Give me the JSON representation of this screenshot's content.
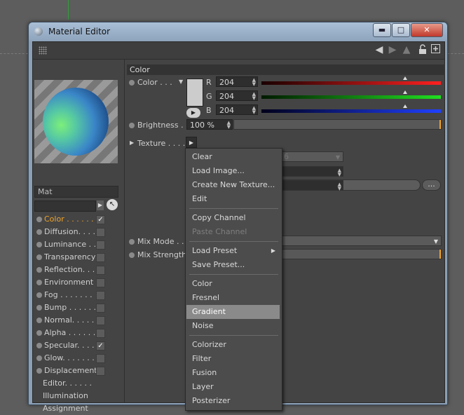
{
  "window": {
    "title": "Material Editor"
  },
  "titlebar_buttons": {
    "minimize": "▬",
    "maximize": "□",
    "close": "✕"
  },
  "material": {
    "name": "Mat"
  },
  "channels": [
    {
      "label": "Color . . . . . .",
      "checked": true,
      "active": true
    },
    {
      "label": "Diffusion. . . .",
      "checked": false
    },
    {
      "label": "Luminance . .",
      "checked": false
    },
    {
      "label": "Transparency",
      "checked": false
    },
    {
      "label": "Reflection. . .",
      "checked": false
    },
    {
      "label": "Environment",
      "checked": false
    },
    {
      "label": "Fog . . . . . . .",
      "checked": false
    },
    {
      "label": "Bump . . . . . .",
      "checked": false
    },
    {
      "label": "Normal. . . . .",
      "checked": false
    },
    {
      "label": "Alpha . . . . . .",
      "checked": false
    },
    {
      "label": "Specular. . . .",
      "checked": true
    },
    {
      "label": "Glow. . . . . . .",
      "checked": false
    },
    {
      "label": "Displacement",
      "checked": false
    }
  ],
  "other_items": [
    "Editor. . . . . .",
    "Illumination",
    "Assignment"
  ],
  "section": {
    "title": "Color"
  },
  "color_props": {
    "color_label": "Color . . .",
    "r_label": "R",
    "g_label": "G",
    "b_label": "B",
    "r_value": "204",
    "g_value": "204",
    "b_value": "204",
    "brightness_label": "Brightness . .",
    "brightness_value": "100 %",
    "texture_label": "Texture . . . . .",
    "texture_button": "Gradient",
    "texture_more": "...",
    "mix_mode_label": "Mix Mode . .",
    "mix_strength_label": "Mix Strength",
    "hidden_value": "6"
  },
  "sliders": {
    "r_level": 0.8,
    "g_level": 0.8,
    "b_level": 0.8
  },
  "context_menu": {
    "items": [
      {
        "label": "Clear"
      },
      {
        "label": "Load Image..."
      },
      {
        "label": "Create New Texture..."
      },
      {
        "label": "Edit"
      },
      {
        "label": "Copy Channel"
      },
      {
        "label": "Paste Channel",
        "disabled": true
      },
      {
        "label": "Load Preset",
        "submenu": true
      },
      {
        "label": "Save Preset..."
      },
      {
        "label": "Color"
      },
      {
        "label": "Fresnel"
      },
      {
        "label": "Gradient",
        "highlighted": true
      },
      {
        "label": "Noise"
      },
      {
        "label": "Colorizer"
      },
      {
        "label": "Filter"
      },
      {
        "label": "Fusion"
      },
      {
        "label": "Layer"
      },
      {
        "label": "Posterizer"
      }
    ]
  },
  "colors": {
    "accent": "#f0a42a",
    "red_slider": "#ff2020",
    "green_slider": "#20e020",
    "blue_slider": "#2040ff"
  }
}
